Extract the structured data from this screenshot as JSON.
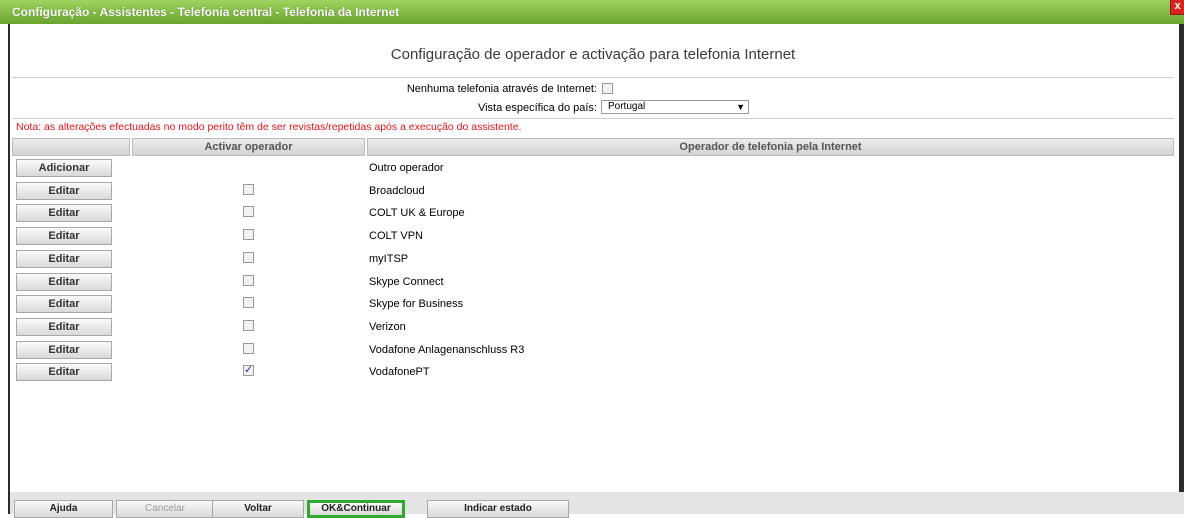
{
  "window": {
    "title": "Configuração - Assistentes - Telefonia central - Telefonia da Internet",
    "close_glyph": "x"
  },
  "page": {
    "heading": "Configuração de operador e activação para telefonia Internet"
  },
  "options": {
    "no_internet_label": "Nenhuma telefonia através de Internet:",
    "no_internet_checked": false,
    "country_label": "Vista específica do país:",
    "country_value": "Portugal"
  },
  "note": "Nota: as alterações efectuadas no modo perito têm de ser revistas/repetidas após a execução do assistente.",
  "table": {
    "columns": [
      "",
      "Activar operador",
      "Operador de telefonia pela Internet"
    ],
    "rows": [
      {
        "button": "Adicionar",
        "checked": null,
        "name": "Outro operador"
      },
      {
        "button": "Editar",
        "checked": false,
        "name": "Broadcloud"
      },
      {
        "button": "Editar",
        "checked": false,
        "name": "COLT UK & Europe"
      },
      {
        "button": "Editar",
        "checked": false,
        "name": "COLT VPN"
      },
      {
        "button": "Editar",
        "checked": false,
        "name": "myITSP"
      },
      {
        "button": "Editar",
        "checked": false,
        "name": "Skype Connect"
      },
      {
        "button": "Editar",
        "checked": false,
        "name": "Skype for Business"
      },
      {
        "button": "Editar",
        "checked": false,
        "name": "Verizon"
      },
      {
        "button": "Editar",
        "checked": false,
        "name": "Vodafone Anlagenanschluss R3"
      },
      {
        "button": "Editar",
        "checked": true,
        "name": "VodafonePT"
      }
    ]
  },
  "footer": {
    "help": "Ajuda",
    "cancel": "Cancelar",
    "back": "Voltar",
    "ok_continue": "OK&Continuar",
    "show_status": "Indicar estado"
  },
  "colors": {
    "title_bar": "#7cb83f",
    "note_text": "#e0141b",
    "focus_border": "#2fa82f"
  }
}
